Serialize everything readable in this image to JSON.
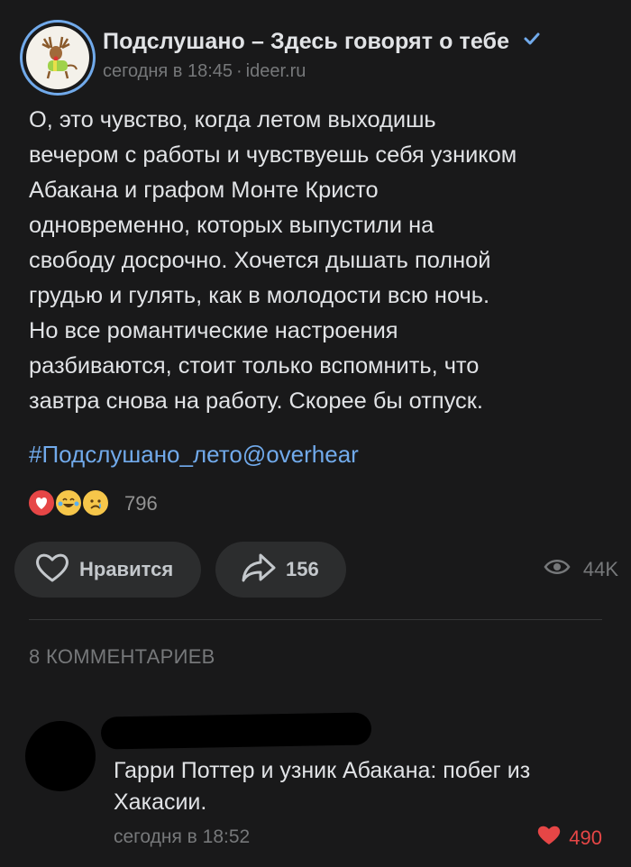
{
  "post": {
    "author": "Подслушано – Здесь говорят о тебе",
    "time": "сегодня в 18:45",
    "source": "ideer.ru",
    "text_lines": [
      "О, это чувство, когда летом выходишь",
      "вечером с работы и чувствуешь себя узником",
      "Абакана и графом Монте Кристо",
      "одновременно, которых выпустили на",
      "свободу досрочно. Хочется дышать полной",
      "грудью и гулять, как в молодости всю ночь.",
      "Но все романтические настроения",
      "разбиваются, стоит только вспомнить, что",
      "завтра снова на работу. Скорее бы отпуск."
    ],
    "hashtag": "#Подслушано_лето@overhear",
    "reactions_count": "796",
    "like_label": "Нравится",
    "shares_count": "156",
    "views_count": "44K"
  },
  "comments": {
    "header": "8 КОММЕНТАРИЕВ",
    "items": [
      {
        "text": "Гарри Поттер и узник Абакана: побег из Хакасии.",
        "time": "сегодня в 18:52",
        "likes": "490"
      }
    ]
  },
  "colors": {
    "background": "#19191a",
    "accent": "#71aaeb",
    "like_red": "#e64646"
  }
}
